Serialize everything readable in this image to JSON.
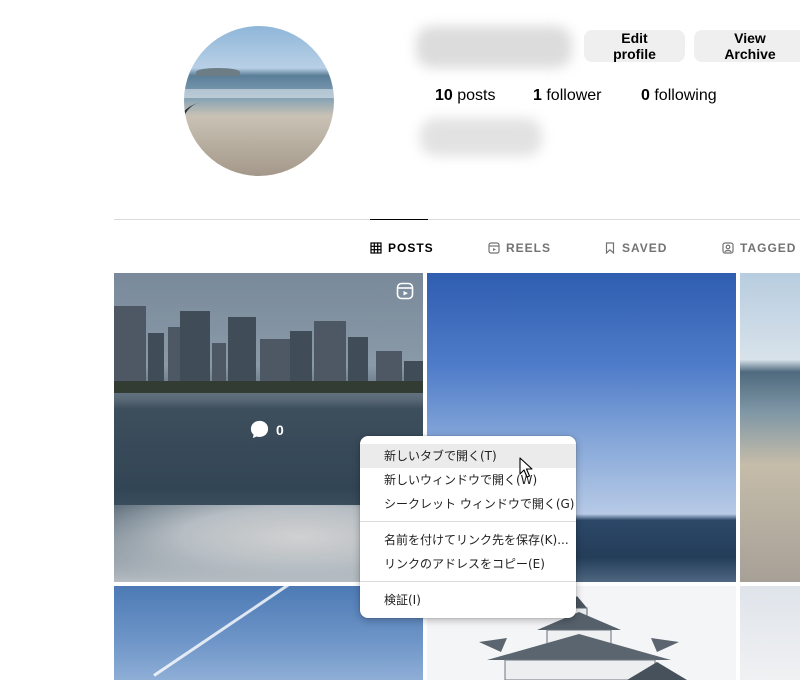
{
  "profile": {
    "edit_profile_label": "Edit profile",
    "view_archive_label": "View Archive",
    "stats": {
      "posts_count": "10",
      "posts_label": "posts",
      "followers_count": "1",
      "followers_label": "follower",
      "following_count": "0",
      "following_label": "following"
    }
  },
  "tabs": [
    {
      "label": "POSTS",
      "icon": "grid-icon",
      "active": true
    },
    {
      "label": "REELS",
      "icon": "reels-icon",
      "active": false
    },
    {
      "label": "SAVED",
      "icon": "bookmark-icon",
      "active": false
    },
    {
      "label": "TAGGED",
      "icon": "tag-person-icon",
      "active": false
    }
  ],
  "grid": {
    "hovered_tile": {
      "comment_count": "0",
      "type_icon": "reels-icon"
    }
  },
  "context_menu": {
    "items": [
      "新しいタブで開く(T)",
      "新しいウィンドウで開く(W)",
      "シークレット ウィンドウで開く(G)",
      "名前を付けてリンク先を保存(K)...",
      "リンクのアドレスをコピー(E)",
      "検証(I)"
    ]
  },
  "colors": {
    "button_bg": "#efefef",
    "tab_inactive": "#737373",
    "divider": "#dbdbdb"
  }
}
